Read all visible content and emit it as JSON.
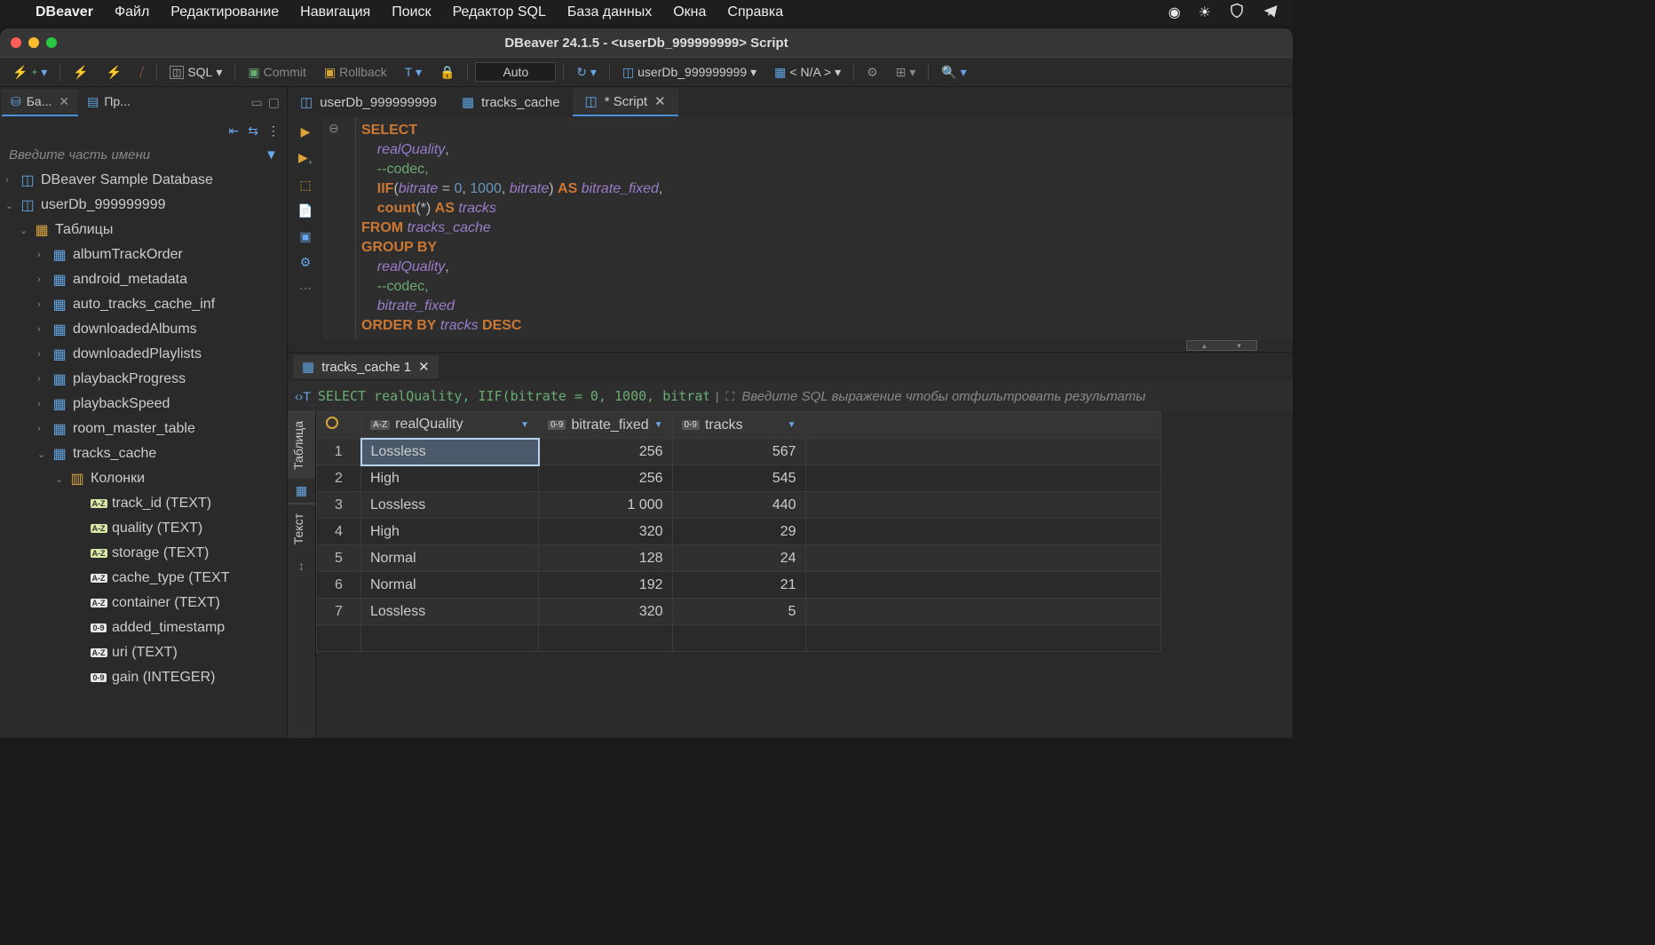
{
  "menubar": {
    "app": "DBeaver",
    "items": [
      "Файл",
      "Редактирование",
      "Навигация",
      "Поиск",
      "Редактор SQL",
      "База данных",
      "Окна",
      "Справка"
    ]
  },
  "window": {
    "title": "DBeaver 24.1.5 - <userDb_999999999> Script"
  },
  "toolbar": {
    "sql_label": "SQL",
    "commit_label": "Commit",
    "rollback_label": "Rollback",
    "auto_label": "Auto",
    "db_label": "userDb_999999999",
    "schema_label": "< N/A >"
  },
  "sidebar": {
    "tabs": [
      {
        "icon": "database",
        "label": "Ба...",
        "active": true,
        "closable": true
      },
      {
        "icon": "project",
        "label": "Пр...",
        "active": false,
        "closable": false
      }
    ],
    "filter_placeholder": "Введите часть имени",
    "tree": [
      {
        "depth": 0,
        "arrow": "›",
        "icon": "db",
        "label": "DBeaver Sample Database"
      },
      {
        "depth": 0,
        "arrow": "⌄",
        "icon": "db",
        "label": "userDb_999999999"
      },
      {
        "depth": 1,
        "arrow": "⌄",
        "icon": "folder",
        "label": "Таблицы"
      },
      {
        "depth": 2,
        "arrow": "›",
        "icon": "table",
        "label": "albumTrackOrder"
      },
      {
        "depth": 2,
        "arrow": "›",
        "icon": "table",
        "label": "android_metadata"
      },
      {
        "depth": 2,
        "arrow": "›",
        "icon": "table",
        "label": "auto_tracks_cache_inf"
      },
      {
        "depth": 2,
        "arrow": "›",
        "icon": "table",
        "label": "downloadedAlbums"
      },
      {
        "depth": 2,
        "arrow": "›",
        "icon": "table",
        "label": "downloadedPlaylists"
      },
      {
        "depth": 2,
        "arrow": "›",
        "icon": "table",
        "label": "playbackProgress"
      },
      {
        "depth": 2,
        "arrow": "›",
        "icon": "table",
        "label": "playbackSpeed"
      },
      {
        "depth": 2,
        "arrow": "›",
        "icon": "table",
        "label": "room_master_table"
      },
      {
        "depth": 2,
        "arrow": "⌄",
        "icon": "table",
        "label": "tracks_cache"
      },
      {
        "depth": 3,
        "arrow": "⌄",
        "icon": "cols",
        "label": "Колонки"
      },
      {
        "depth": 4,
        "arrow": "",
        "icon": "col-az-key",
        "label": "track_id (TEXT)"
      },
      {
        "depth": 4,
        "arrow": "",
        "icon": "col-az-key",
        "label": "quality (TEXT)"
      },
      {
        "depth": 4,
        "arrow": "",
        "icon": "col-az-key",
        "label": "storage (TEXT)"
      },
      {
        "depth": 4,
        "arrow": "",
        "icon": "col-az",
        "label": "cache_type (TEXT"
      },
      {
        "depth": 4,
        "arrow": "",
        "icon": "col-az",
        "label": "container (TEXT)"
      },
      {
        "depth": 4,
        "arrow": "",
        "icon": "col-09",
        "label": "added_timestamp"
      },
      {
        "depth": 4,
        "arrow": "",
        "icon": "col-az",
        "label": "uri (TEXT)"
      },
      {
        "depth": 4,
        "arrow": "",
        "icon": "col-09",
        "label": "gain (INTEGER)"
      }
    ]
  },
  "editor": {
    "tabs": [
      {
        "icon": "db",
        "label": "userDb_999999999",
        "active": false,
        "closable": false
      },
      {
        "icon": "table",
        "label": "tracks_cache",
        "active": false,
        "closable": false
      },
      {
        "icon": "script",
        "label": "*<userDb_999999999> Script",
        "active": true,
        "closable": true
      }
    ],
    "sql_lines": [
      {
        "tokens": [
          {
            "t": "kw",
            "v": "SELECT"
          }
        ]
      },
      {
        "tokens": [
          {
            "t": "sp",
            "v": "    "
          },
          {
            "t": "ident",
            "v": "realQuality"
          },
          {
            "t": "p",
            "v": ","
          }
        ]
      },
      {
        "tokens": [
          {
            "t": "sp",
            "v": "    "
          },
          {
            "t": "comment",
            "v": "--codec,"
          }
        ]
      },
      {
        "tokens": [
          {
            "t": "sp",
            "v": "    "
          },
          {
            "t": "kw",
            "v": "IIF"
          },
          {
            "t": "p",
            "v": "("
          },
          {
            "t": "ident",
            "v": "bitrate"
          },
          {
            "t": "p",
            "v": " = "
          },
          {
            "t": "num",
            "v": "0"
          },
          {
            "t": "p",
            "v": ", "
          },
          {
            "t": "num",
            "v": "1000"
          },
          {
            "t": "p",
            "v": ", "
          },
          {
            "t": "ident",
            "v": "bitrate"
          },
          {
            "t": "p",
            "v": ") "
          },
          {
            "t": "kw",
            "v": "AS"
          },
          {
            "t": "p",
            "v": " "
          },
          {
            "t": "ident",
            "v": "bitrate_fixed"
          },
          {
            "t": "p",
            "v": ","
          }
        ]
      },
      {
        "tokens": [
          {
            "t": "sp",
            "v": "    "
          },
          {
            "t": "kw",
            "v": "count"
          },
          {
            "t": "p",
            "v": "(*) "
          },
          {
            "t": "kw",
            "v": "AS"
          },
          {
            "t": "p",
            "v": " "
          },
          {
            "t": "ident",
            "v": "tracks"
          }
        ]
      },
      {
        "tokens": [
          {
            "t": "kw",
            "v": "FROM"
          },
          {
            "t": "p",
            "v": " "
          },
          {
            "t": "ident",
            "v": "tracks_cache"
          }
        ]
      },
      {
        "tokens": [
          {
            "t": "kw",
            "v": "GROUP BY"
          }
        ]
      },
      {
        "tokens": [
          {
            "t": "sp",
            "v": "    "
          },
          {
            "t": "ident",
            "v": "realQuality"
          },
          {
            "t": "p",
            "v": ","
          }
        ]
      },
      {
        "tokens": [
          {
            "t": "sp",
            "v": "    "
          },
          {
            "t": "comment",
            "v": "--codec,"
          }
        ]
      },
      {
        "tokens": [
          {
            "t": "sp",
            "v": "    "
          },
          {
            "t": "ident",
            "v": "bitrate_fixed"
          }
        ]
      },
      {
        "tokens": [
          {
            "t": "kw",
            "v": "ORDER BY"
          },
          {
            "t": "p",
            "v": " "
          },
          {
            "t": "ident",
            "v": "tracks"
          },
          {
            "t": "p",
            "v": " "
          },
          {
            "t": "kw",
            "v": "DESC"
          }
        ]
      }
    ]
  },
  "results": {
    "tab_label": "tracks_cache 1",
    "sql_preview": "SELECT realQuality, IIF(bitrate = 0, 1000, bitrat",
    "filter_placeholder": "Введите SQL выражение чтобы отфильтровать результаты",
    "side_tabs": [
      "Таблица",
      "Текст"
    ],
    "columns": [
      {
        "name": "realQuality",
        "type": "A-Z"
      },
      {
        "name": "bitrate_fixed",
        "type": "0-9"
      },
      {
        "name": "tracks",
        "type": "0-9"
      }
    ],
    "rows": [
      {
        "n": 1,
        "realQuality": "Lossless",
        "bitrate_fixed": "256",
        "tracks": "567",
        "selected": true
      },
      {
        "n": 2,
        "realQuality": "High",
        "bitrate_fixed": "256",
        "tracks": "545"
      },
      {
        "n": 3,
        "realQuality": "Lossless",
        "bitrate_fixed": "1 000",
        "tracks": "440"
      },
      {
        "n": 4,
        "realQuality": "High",
        "bitrate_fixed": "320",
        "tracks": "29"
      },
      {
        "n": 5,
        "realQuality": "Normal",
        "bitrate_fixed": "128",
        "tracks": "24"
      },
      {
        "n": 6,
        "realQuality": "Normal",
        "bitrate_fixed": "192",
        "tracks": "21"
      },
      {
        "n": 7,
        "realQuality": "Lossless",
        "bitrate_fixed": "320",
        "tracks": "5"
      }
    ]
  }
}
